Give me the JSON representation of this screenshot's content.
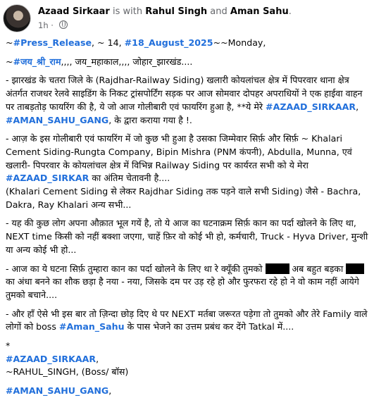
{
  "header": {
    "author": "Azaad Sirkaar",
    "is_with": "is with",
    "person1": "Rahul Singh",
    "and": "and",
    "person2": "Aman Sahu",
    "dot": ".",
    "time": "1h",
    "separator": "·"
  },
  "post": {
    "l1_prefix": "~",
    "l1_tag1": "#Press_Release",
    "l1_mid": ", ~ 14, ",
    "l1_tag2": "#18_August_2025",
    "l1_suffix": "~~Monday,",
    "l2_prefix": "~",
    "l2_tag": "#जय_श्री_राम",
    "l2_suffix": ",,,, जय_महाकाल,,,, जोहार_झारखंड....",
    "p1_text": "- झारखंड के चतरा जिले के (Rajdhar-Railway Siding) खलारी कोयलांचल क्षेत्र में पिपरवार थाना क्षेत्र अंतर्गत राजधर रेलवे साइडिंग के निकट ट्रांसपोर्टिंग सड़क पर आज सोमवार दोपहर अपराधियों ने एक हाईवा वाहन पर ताबड़तोड़ फायरिंग की है, ये जो आज गोलीबारी एवं फायरिंग हुआ है, **ये मेरे ",
    "p1_tag1": "#AZAAD_SIRKAAR",
    "p1_sep": ", ",
    "p1_tag2": "#AMAN_SAHU_GANG",
    "p1_end": ", के द्वारा कराया गया है !.",
    "p2_text": "- आज़ के इस गोलीबारी एवं फायरिंग में जो कुछ भी हुआ है उसका जिम्मेवार सिर्फ़ और सिर्फ़ ~ Khalari Cement Siding-Rungta Company, Bipin Mishra (PNM कंपनी), Abdulla, Munna, एवं खलारी- पिपरवार के कोयलांचल क्षेत्र में विभिन्न Railway Siding पर कार्यरत सभी को ये मेरा ",
    "p2_tag": "#AZAAD_SIRKAR",
    "p2_end": " का अंतिम चेतावनी है....",
    "p3_text": "(Khalari Cement Siding से लेकर Rajdhar Siding तक पड़ने वाले सभी Siding) जैसे - Bachra, Dakra, Ray Khalari अन्य सभी...",
    "p4_text": "- यह की कुछ लोग अपना औक़ात भूल गयें है, तो ये आज का घटनाक्रम सिर्फ़ कान का पर्दा खोलने के लिए था, NEXT time किसी को नहीं बक्शा जएगा, चाहें फ़िर वो कोई भी हो, कर्मचारी, Truck - Hyva Driver, मुन्शी या अन्य कोई भी हो...",
    "p5_a": "- आज का ये घटना सिर्फ़ तुम्हारा कान का पर्दा खोलने के लिए था रे क्यूँकी तुमको ",
    "p5_b": " अब बहुत बड़का ",
    "p5_c": " का अंधा बनने का शौक छड़ा है नया - नया, जिसके दम पर उड़ रहे हो और फुरफरा रहे हो ने वो काम नहीं आयेगे तुमको बचाने....",
    "p6_a": "- और हाँ ऐसे भी इस बार तो ज़िन्दा छोड़ दिए थे पर NEXT मर्तबा जरूरत पड़ेगा तो तुमको और तेरे Family वाले लोगों को boss ",
    "p6_tag": "#Aman_Sahu",
    "p6_b": " के पास भेजने का उत्तम प्रबंध कर देंगे Tatkal में....",
    "star": "*",
    "sig_tag1": "#AZAAD_SIRKAAR",
    "sig_tag1_end": ",",
    "sig_line2": "~RAHUL_SINGH, (Boss/ बॉस)",
    "sig_tag2": "#AMAN_SAHU_GANG",
    "sig_tag2_end": ","
  }
}
